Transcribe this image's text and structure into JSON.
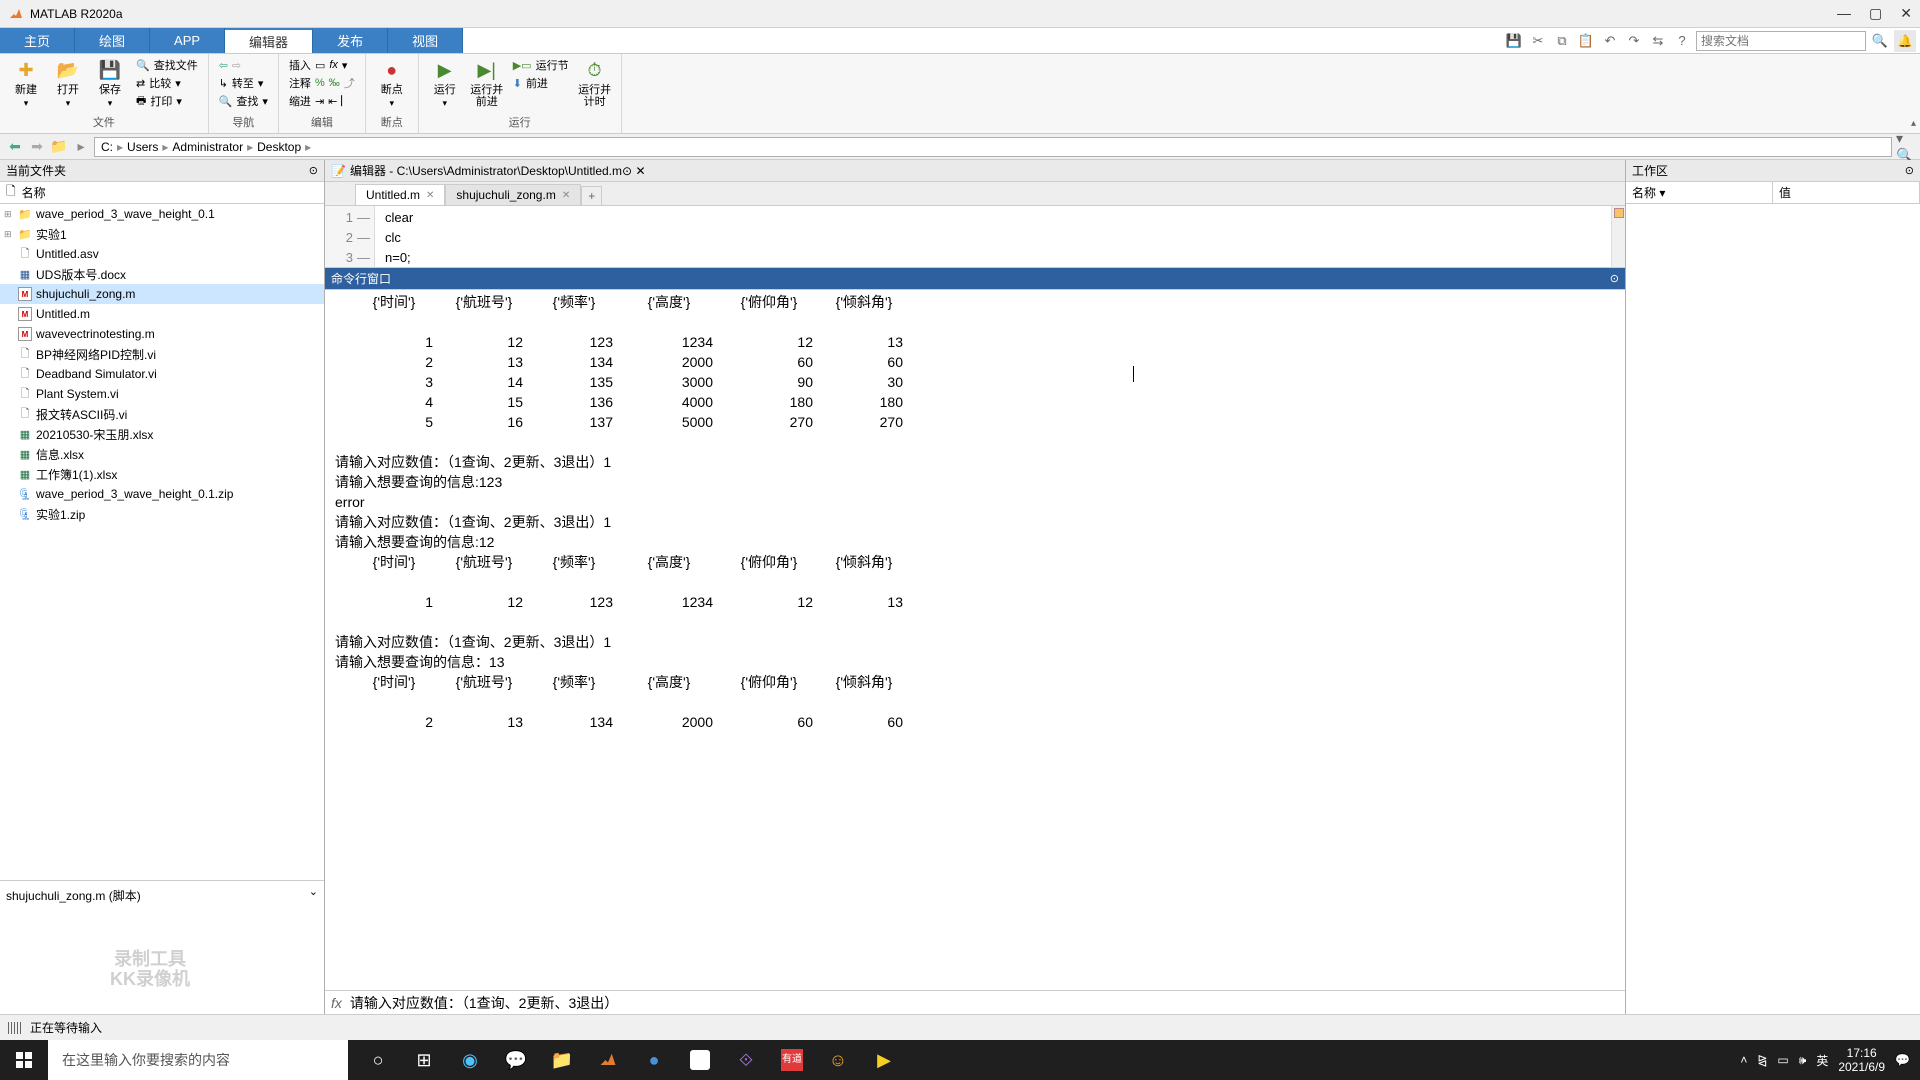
{
  "title": "MATLAB R2020a",
  "tabs": {
    "home": "主页",
    "plots": "绘图",
    "app": "APP",
    "editor": "编辑器",
    "publish": "发布",
    "view": "视图"
  },
  "search_placeholder": "搜索文档",
  "ribbon": {
    "file_group": "文件",
    "nav_group": "导航",
    "edit_group": "编辑",
    "bp_group": "断点",
    "run_group": "运行",
    "new": "新建",
    "open": "打开",
    "save": "保存",
    "find_files": "查找文件",
    "compare": "比较",
    "print": "打印",
    "goto": "转至",
    "find": "查找",
    "insert": "插入",
    "comment": "注释",
    "indent": "缩进",
    "breakpoint": "断点",
    "run": "运行",
    "run_advance": "运行并\n前进",
    "run_section": "运行节",
    "advance": "前进",
    "run_time": "运行并\n计时"
  },
  "path_parts": [
    "C:",
    "Users",
    "Administrator",
    "Desktop"
  ],
  "current_folder": {
    "title": "当前文件夹",
    "col_name": "名称",
    "files": [
      {
        "name": "wave_period_3_wave_height_0.1",
        "type": "folder",
        "expand": true
      },
      {
        "name": "实验1",
        "type": "folder",
        "expand": true
      },
      {
        "name": "Untitled.asv",
        "type": "asv"
      },
      {
        "name": "UDS版本号.docx",
        "type": "docx"
      },
      {
        "name": "shujuchuli_zong.m",
        "type": "m",
        "selected": true
      },
      {
        "name": "Untitled.m",
        "type": "m"
      },
      {
        "name": "wavevectrinotesting.m",
        "type": "m"
      },
      {
        "name": "BP神经网络PID控制.vi",
        "type": "vi"
      },
      {
        "name": "Deadband Simulator.vi",
        "type": "vi"
      },
      {
        "name": "Plant System.vi",
        "type": "vi"
      },
      {
        "name": "报文转ASCII码.vi",
        "type": "vi"
      },
      {
        "name": "20210530-宋玉朋.xlsx",
        "type": "xlsx"
      },
      {
        "name": "信息.xlsx",
        "type": "xlsx"
      },
      {
        "name": "工作簿1(1).xlsx",
        "type": "xlsx"
      },
      {
        "name": "wave_period_3_wave_height_0.1.zip",
        "type": "zip"
      },
      {
        "name": "实验1.zip",
        "type": "zip"
      }
    ],
    "detail": "shujuchuli_zong.m  (脚本)"
  },
  "watermark": {
    "l1": "录制工具",
    "l2": "KK录像机"
  },
  "editor": {
    "title": "编辑器 - C:\\Users\\Administrator\\Desktop\\Untitled.m",
    "tabs": [
      {
        "name": "Untitled.m",
        "active": true
      },
      {
        "name": "shujuchuli_zong.m",
        "active": false
      }
    ],
    "lines": [
      "clear",
      "clc",
      "n=0;"
    ]
  },
  "cmd": {
    "title": "命令行窗口",
    "headers": [
      "{'时间'}",
      "{'航班号'}",
      "{'频率'}",
      "{'高度'}",
      "{'俯仰角'}",
      "{'倾斜角'}"
    ],
    "rows": [
      [
        "1",
        "12",
        "123",
        "1234",
        "12",
        "13"
      ],
      [
        "2",
        "13",
        "134",
        "2000",
        "60",
        "60"
      ],
      [
        "3",
        "14",
        "135",
        "3000",
        "90",
        "30"
      ],
      [
        "4",
        "15",
        "136",
        "4000",
        "180",
        "180"
      ],
      [
        "5",
        "16",
        "137",
        "5000",
        "270",
        "270"
      ]
    ],
    "p1": "请输入对应数值：（1查询、2更新、3退出）1",
    "p2": "请输入想要查询的信息:123",
    "err": "error",
    "p3": "请输入对应数值：（1查询、2更新、3退出）1",
    "p4": "请输入想要查询的信息:12",
    "row_q1": [
      "1",
      "12",
      "123",
      "1234",
      "12",
      "13"
    ],
    "p5": "请输入对应数值：（1查询、2更新、3退出）1",
    "p6": "请输入想要查询的信息：13",
    "row_q2": [
      "2",
      "13",
      "134",
      "2000",
      "60",
      "60"
    ],
    "prompt": "请输入对应数值：（1查询、2更新、3退出）"
  },
  "workspace": {
    "title": "工作区",
    "col_name": "名称 ▾",
    "col_value": "值"
  },
  "status": "正在等待输入",
  "taskbar": {
    "search": "在这里输入你要搜索的内容",
    "ime": "英",
    "time": "17:16",
    "date": "2021/6/9"
  }
}
